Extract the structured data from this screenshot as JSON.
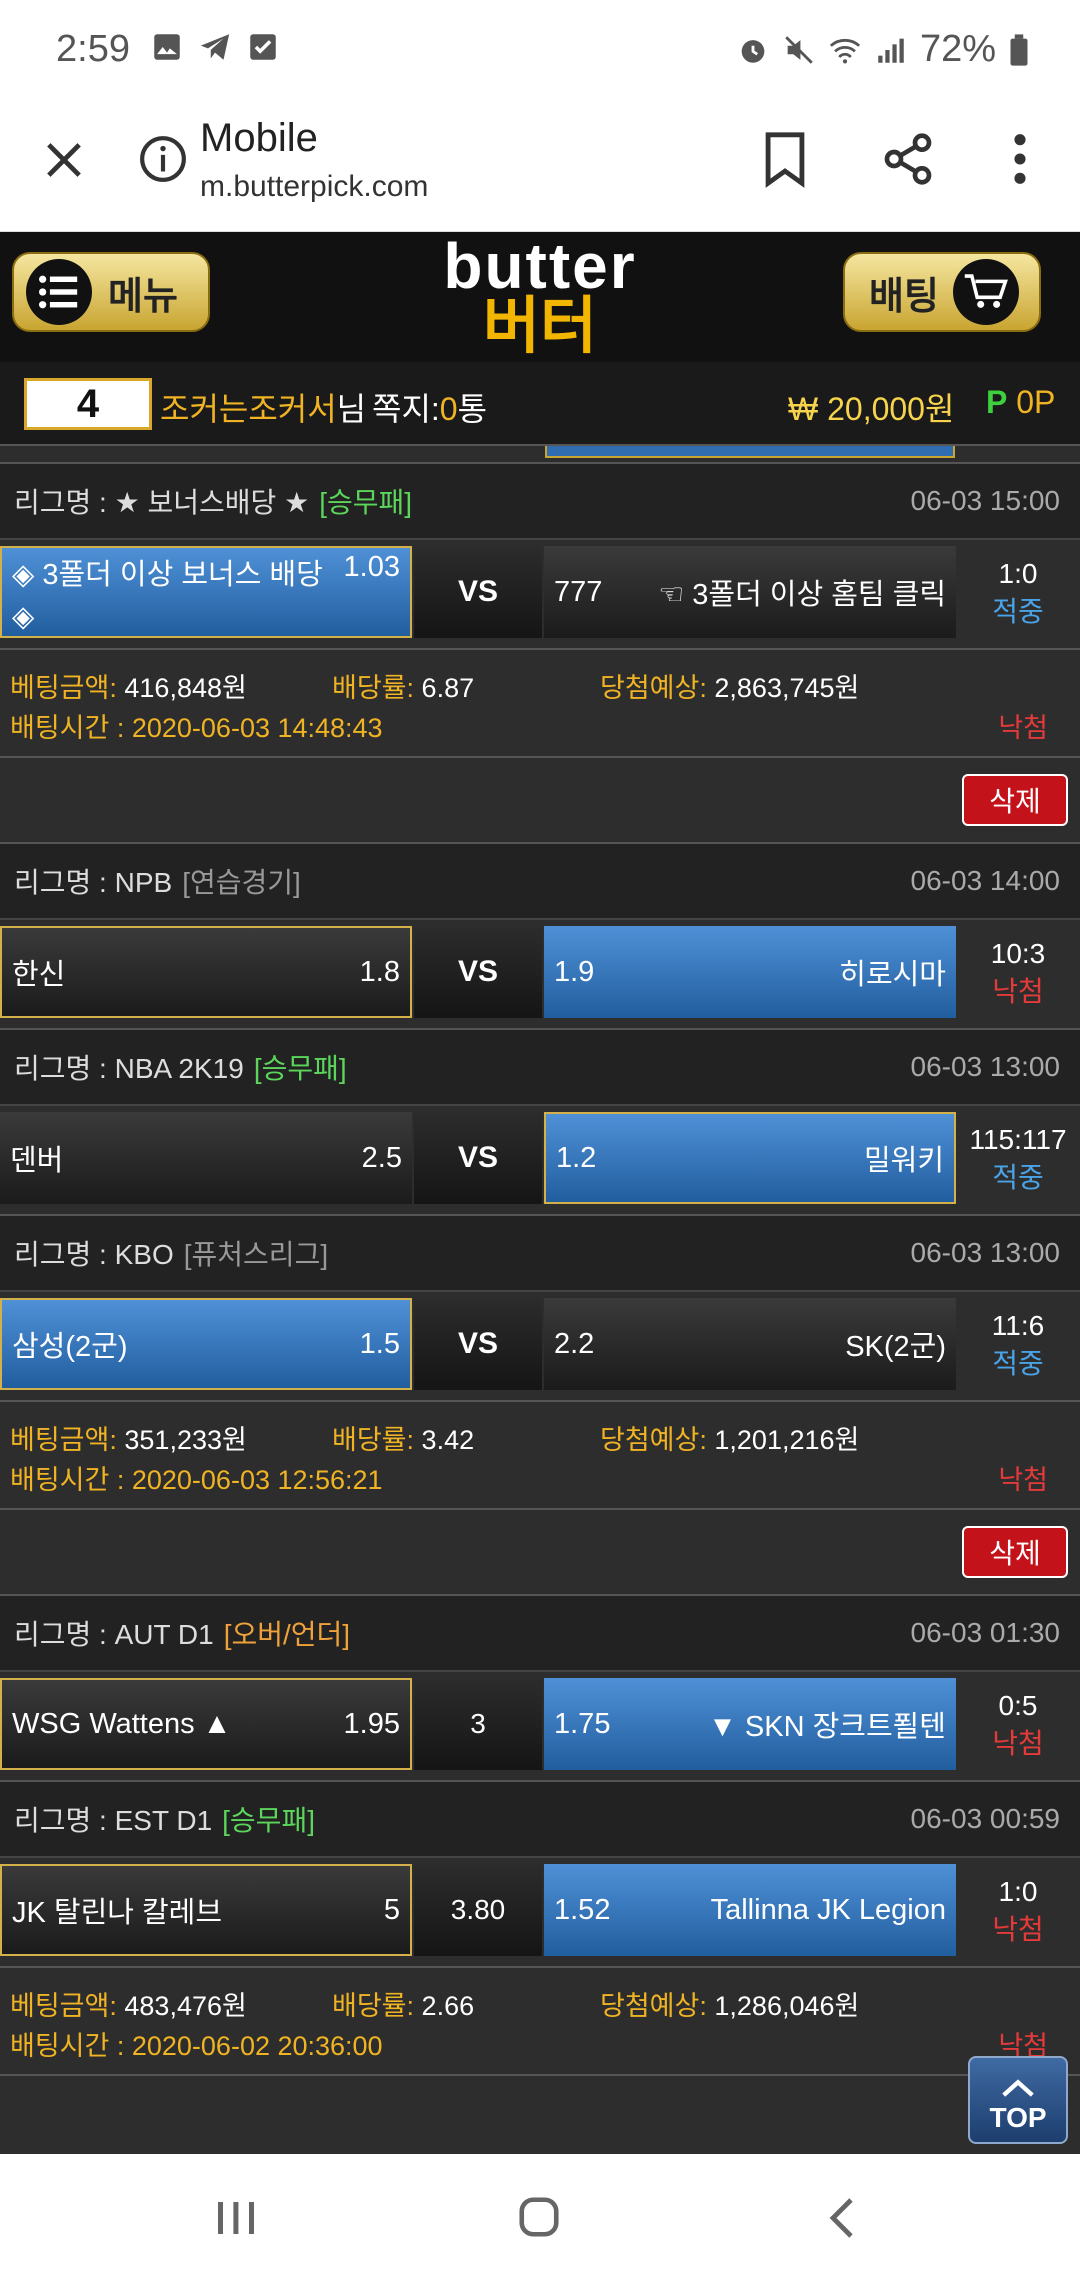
{
  "status_bar": {
    "time": "2:59",
    "battery": "72%",
    "icons_left": [
      "image-icon",
      "telegram-icon",
      "check-icon"
    ],
    "icons_right": [
      "alarm-icon",
      "mute-icon",
      "wifi-icon",
      "signal-icon",
      "battery-icon"
    ]
  },
  "browser": {
    "title": "Mobile",
    "url": "m.butterpick.com"
  },
  "header": {
    "menu_label": "메뉴",
    "bet_label": "배팅",
    "logo_en": "butter",
    "logo_ko": "버터"
  },
  "user": {
    "level": "4",
    "name": "조커는조커서",
    "name_suffix": "님",
    "message_label": "쪽지:",
    "message_count": "0",
    "message_unit": "통",
    "money": "₩ 20,000원",
    "point_label": "P",
    "point_value": "0P"
  },
  "bets": [
    {
      "league": "리그명 : ★ 보너스배당 ★",
      "tag": "[승무패]",
      "date": "06-03 15:00",
      "home": "◈ 3폴더 이상 보너스 배당",
      "home_extra": "◈",
      "home_odds": "1.03",
      "mid": "VS",
      "away_odds": "777",
      "away": "☜ 3폴더 이상 홈팀 클릭",
      "score": "1:0",
      "result": "적중"
    },
    {
      "league": "리그명 : NPB",
      "tag": "[연습경기]",
      "date": "06-03 14:00",
      "home": "한신",
      "home_odds": "1.8",
      "mid": "VS",
      "away_odds": "1.9",
      "away": "히로시마",
      "score": "10:3",
      "result": "낙첨"
    },
    {
      "league": "리그명 : NBA 2K19",
      "tag": "[승무패]",
      "date": "06-03 13:00",
      "home": "덴버",
      "home_odds": "2.5",
      "mid": "VS",
      "away_odds": "1.2",
      "away": "밀워키",
      "score": "115:117",
      "result": "적중"
    },
    {
      "league": "리그명 : KBO",
      "tag": "[퓨처스리그]",
      "date": "06-03 13:00",
      "home": "삼성(2군)",
      "home_odds": "1.5",
      "mid": "VS",
      "away_odds": "2.2",
      "away": "SK(2군)",
      "score": "11:6",
      "result": "적중"
    },
    {
      "league": "리그명 : AUT D1",
      "tag": "[오버/언더]",
      "date": "06-03 01:30",
      "home": "WSG Wattens ▲",
      "home_odds": "1.95",
      "mid": "3",
      "away_odds": "1.75",
      "away": "▼ SKN 장크트푈텐",
      "score": "0:5",
      "result": "낙첨"
    },
    {
      "league": "리그명 : EST D1",
      "tag": "[승무패]",
      "date": "06-03 00:59",
      "home": "JK 탈린나 칼레브",
      "home_odds": "5",
      "mid": "3.80",
      "away_odds": "1.52",
      "away": "Tallinna JK Legion",
      "score": "1:0",
      "result": "낙첨"
    }
  ],
  "summaries": [
    {
      "amount_label": "베팅금액:",
      "amount": "416,848원",
      "rate_label": "배당률:",
      "rate": "6.87",
      "expect_label": "당첨예상:",
      "expect": "2,863,745원",
      "time": "배팅시간 : 2020-06-03 14:48:43",
      "status": "낙첨"
    },
    {
      "amount_label": "베팅금액:",
      "amount": "351,233원",
      "rate_label": "배당률:",
      "rate": "3.42",
      "expect_label": "당첨예상:",
      "expect": "1,201,216원",
      "time": "배팅시간 : 2020-06-03 12:56:21",
      "status": "낙첨"
    },
    {
      "amount_label": "베팅금액:",
      "amount": "483,476원",
      "rate_label": "배당률:",
      "rate": "2.66",
      "expect_label": "당첨예상:",
      "expect": "1,286,046원",
      "time": "배팅시간 : 2020-06-02 20:36:00",
      "status": "낙첨"
    }
  ],
  "delete_label": "삭제",
  "top_label": "TOP",
  "colors": {
    "accent_gold": "#f0b323",
    "selected_blue": "#2f6db0",
    "hit": "#4aa3e6",
    "miss": "#e43a3a",
    "delete": "#c4121a"
  }
}
